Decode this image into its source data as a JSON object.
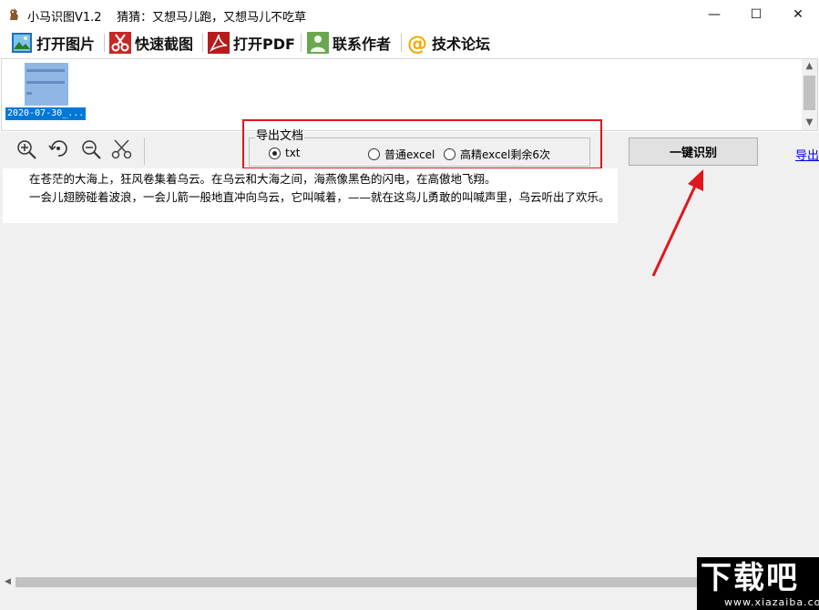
{
  "window": {
    "title": "小马识图V1.2",
    "subtitle": "猜猜：又想马儿跑，又想马儿不吃草",
    "minimize_glyph": "—",
    "maximize_glyph": "☐",
    "close_glyph": "✕"
  },
  "toolbar": {
    "items": [
      {
        "label": "打开图片",
        "icon": "picture-icon"
      },
      {
        "label": "快速截图",
        "icon": "scissors-icon"
      },
      {
        "label": "打开PDF",
        "icon": "pdf-icon"
      },
      {
        "label": "联系作者",
        "icon": "contact-icon"
      },
      {
        "label": "技术论坛",
        "icon": "at-icon"
      }
    ]
  },
  "thumbnails": {
    "items": [
      {
        "caption": "2020-07-30_..."
      }
    ],
    "scroll_up": "▲",
    "scroll_down": "▼"
  },
  "tools": [
    "zoom-in-icon",
    "rotate-icon",
    "zoom-out-icon",
    "crop-scissors-icon"
  ],
  "export": {
    "group_title": "导出文档",
    "options": [
      {
        "label": "txt",
        "selected": true
      },
      {
        "label": "普通excel",
        "selected": false
      },
      {
        "label": "高精excel剩余6次",
        "selected": false
      }
    ]
  },
  "recognize_button": "一键识别",
  "export_link": "导出",
  "output_text": {
    "lines": [
      "在苍茫的大海上，狂风卷集着乌云。在乌云和大海之间，海燕像黑色的闪电，在高傲地飞翔。",
      "一会儿翅膀碰着波浪，一会儿箭一般地直冲向乌云，它叫喊着，——就在这鸟儿勇敢的叫喊声里，乌云听出了欢乐。"
    ]
  },
  "hscroll_left": "◀",
  "watermark": {
    "main": "下载吧",
    "sub": "www.xiazaiba.com"
  },
  "colors": {
    "highlight_red": "#e0161c",
    "selection_blue": "#0078d7"
  }
}
